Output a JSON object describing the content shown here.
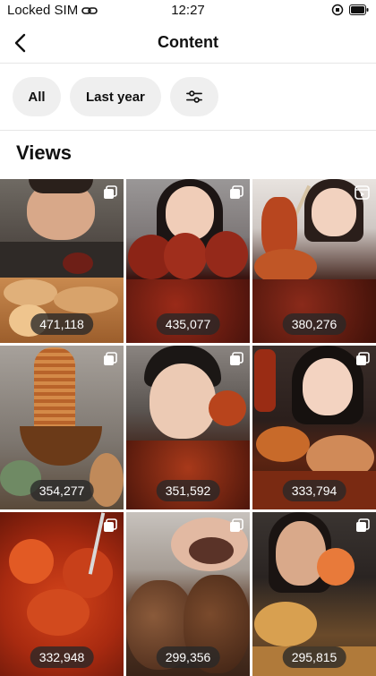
{
  "status": {
    "carrier": "Locked SIM",
    "time": "12:27"
  },
  "header": {
    "title": "Content"
  },
  "filters": {
    "all_label": "All",
    "date_label": "Last year",
    "filter_icon": "sliders-icon"
  },
  "section": {
    "title": "Views"
  },
  "tiles": [
    {
      "views": "471,118"
    },
    {
      "views": "435,077"
    },
    {
      "views": "380,276"
    },
    {
      "views": "354,277"
    },
    {
      "views": "351,592"
    },
    {
      "views": "333,794"
    },
    {
      "views": "332,948"
    },
    {
      "views": "299,356"
    },
    {
      "views": "295,815"
    }
  ]
}
